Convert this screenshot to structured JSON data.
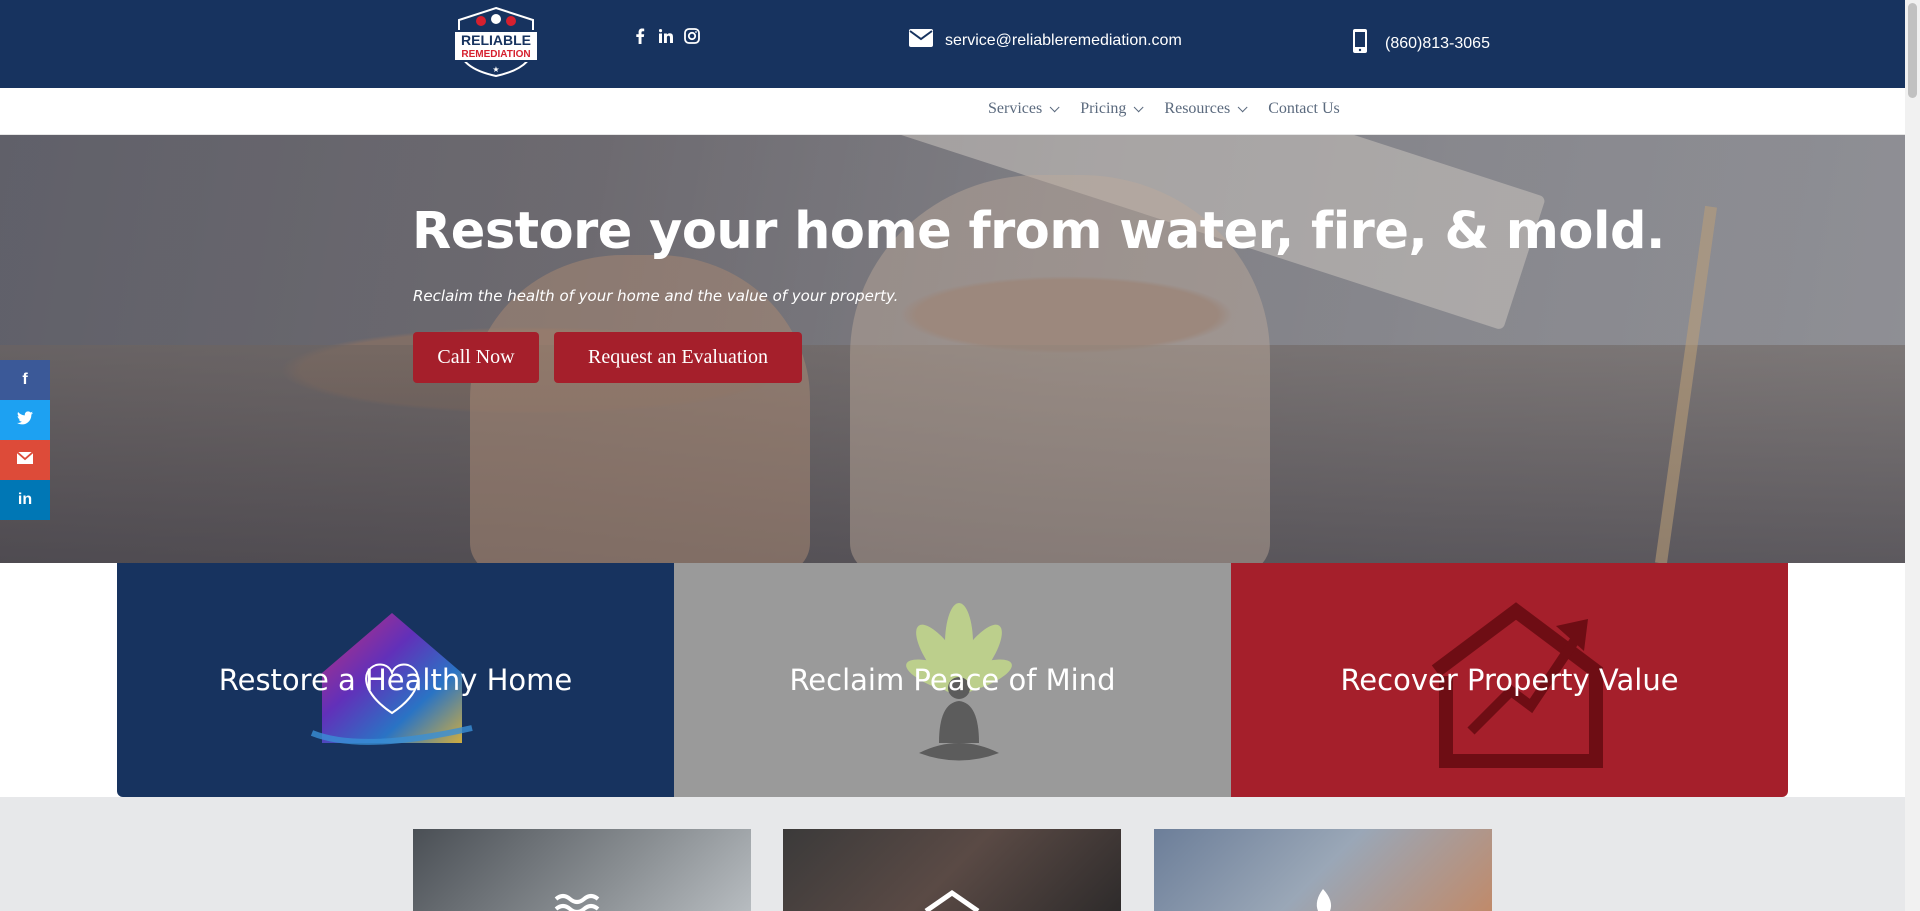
{
  "header": {
    "logo_line1": "RELIABLE",
    "logo_line2": "REMEDIATION",
    "social": [
      "facebook-icon",
      "linkedin-icon",
      "instagram-icon"
    ],
    "email": "service@reliableremediation.com",
    "phone": "(860)813-3065"
  },
  "nav": {
    "items": [
      {
        "label": "Services",
        "has_dropdown": true
      },
      {
        "label": "Pricing",
        "has_dropdown": true
      },
      {
        "label": "Resources",
        "has_dropdown": true
      },
      {
        "label": "Contact Us",
        "has_dropdown": false
      }
    ]
  },
  "hero": {
    "title": "Restore your home from water, fire, & mold.",
    "subtitle": "Reclaim the health of your home and the value of your property.",
    "cta_call": "Call Now",
    "cta_eval": "Request an Evaluation"
  },
  "side_social": [
    {
      "icon": "facebook-icon",
      "glyph": "f",
      "color": "#3b5998"
    },
    {
      "icon": "twitter-icon",
      "glyph": "🐦",
      "color": "#1da1f2"
    },
    {
      "icon": "email-icon",
      "glyph": "✉",
      "color": "#dd4b39"
    },
    {
      "icon": "linkedin-icon",
      "glyph": "in",
      "color": "#0077b5"
    }
  ],
  "cards": [
    {
      "title": "Restore a Healthy Home",
      "color": "#17335f",
      "icon": "heart-home-icon"
    },
    {
      "title": "Reclaim Peace of Mind",
      "color": "#9a9a9a",
      "icon": "meditation-icon"
    },
    {
      "title": "Recover Property Value",
      "color": "#a51f2b",
      "icon": "house-growth-icon"
    }
  ],
  "colors": {
    "primary_navy": "#17335f",
    "accent_red": "#a51f2b",
    "nav_text": "#5b6a7e"
  }
}
